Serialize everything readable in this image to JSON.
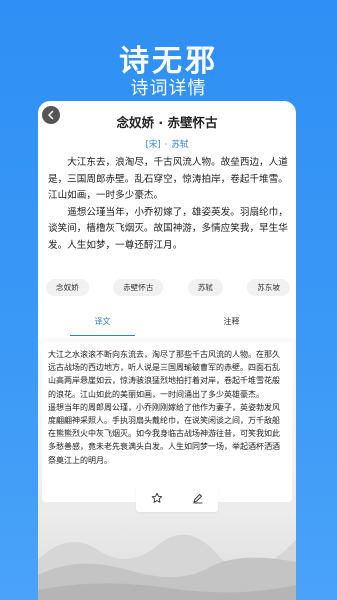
{
  "header": {
    "app_title": "诗无邪",
    "subtitle": "诗词详情"
  },
  "poem": {
    "title": "念奴娇 · 赤壁怀古",
    "dynasty": "[宋]",
    "separator": "·",
    "author": "苏轼",
    "paragraphs": [
      "大江东去，浪淘尽，千古风流人物。故垒西边，人道是，三国周郎赤壁。乱石穿空，惊涛拍岸，卷起千堆雪。江山如画，一时多少豪杰。",
      "遥想公瑾当年，小乔初嫁了，雄姿英发。羽扇纶巾，谈笑间，樯橹灰飞烟灭。故国神游，多情应笑我，早生华发。人生如梦，一尊还酹江月。"
    ]
  },
  "tags": [
    "念奴娇",
    "赤壁怀古",
    "苏轼",
    "苏东坡"
  ],
  "tabs": {
    "translation": "译文",
    "notes": "注释"
  },
  "translation": [
    "大江之水滚滚不断向东流去，淘尽了那些千古风流的人物。在那久远古战场的西边地方，听人说是三国周瑜破曹军的赤壁。四面石乱山高两岸悬崖如云，惊涛骇浪猛烈地拍打着对岸，卷起千堆雪花般的浪花。江山如此的美丽如画，一时间涌出了多少英雄豪杰。",
    "遥想当年的周郎周公瑾，小乔刚刚嫁给了他作为妻子，英姿勃发风度翩翩神采照人。手执羽扇头戴纶巾，在说笑闲谈之间，万千敌船在熊熊烈火中灰飞烟灭。如今我身临古战场神游往昔，可笑我如此多愁善感，竟未老先衰满头白发。人生如同梦一场，举起酒杯洒酒祭奠江上的明月。"
  ],
  "icons": {
    "back": "back-arrow-icon",
    "favorite": "star-icon",
    "edit": "pen-icon"
  },
  "colors": {
    "accent": "#2f7fe0",
    "background": "#3a98f6"
  }
}
